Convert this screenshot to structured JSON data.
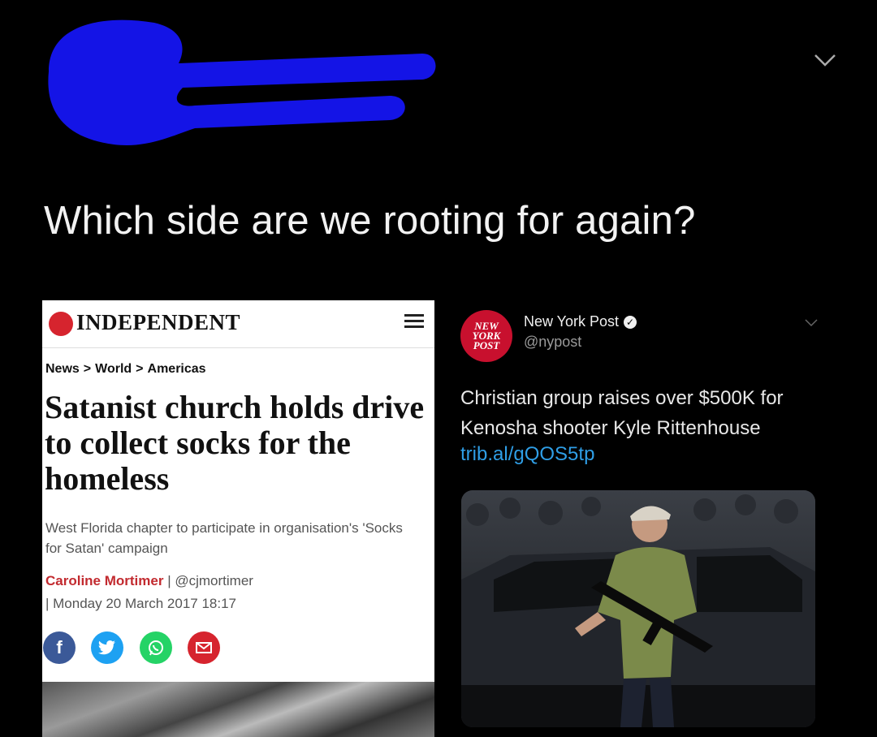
{
  "tweet": {
    "text": "Which side are we rooting for again?"
  },
  "independent": {
    "brand": "INDEPENDENT",
    "breadcrumb": [
      "News",
      "World",
      "Americas"
    ],
    "breadcrumb_separator": ">",
    "headline": "Satanist church holds drive to collect socks for the homeless",
    "subhead": "West Florida chapter to participate in organisation's 'Socks for Satan' campaign",
    "author": "Caroline Mortimer",
    "author_handle": "@cjmortimer",
    "date": "Monday 20 March 2017 18:17",
    "share_icons": [
      "facebook-icon",
      "twitter-icon",
      "whatsapp-icon",
      "email-icon"
    ],
    "colors": {
      "accent_red": "#c22a2f"
    }
  },
  "nypost": {
    "logo_text": "NEW YORK POST",
    "name": "New York Post",
    "handle": "@nypost",
    "text": "Christian group raises over $500K for Kenosha shooter Kyle Rittenhouse",
    "link": "trib.al/gQOS5tp",
    "colors": {
      "link": "#2f9ee6",
      "logo_red": "#c8102e"
    }
  },
  "colors": {
    "background": "#000000",
    "redaction_blue": "#1414e6"
  }
}
